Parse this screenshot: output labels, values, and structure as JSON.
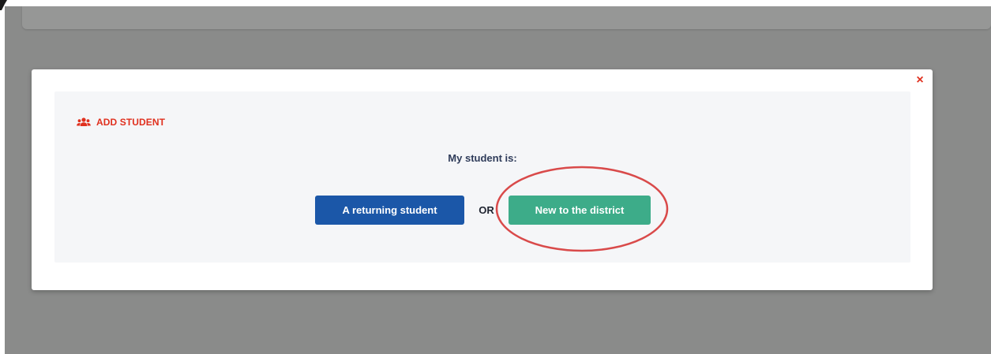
{
  "modal": {
    "close_label": "×",
    "section_icon": "users-icon",
    "section_title": "ADD STUDENT",
    "prompt": "My student is:",
    "returning_label": "A returning student",
    "or_label": "OR",
    "new_label": "New to the district"
  },
  "colors": {
    "accent_red": "#e0301e",
    "primary_blue": "#1b57a8",
    "success_green": "#3dac89",
    "annotation_circle": "#d94a4a",
    "overlay_gray": "#8a8b8a",
    "panel_bg": "#f5f6f8"
  },
  "annotation": {
    "shape": "ellipse",
    "highlights": "new-to-district-button"
  }
}
